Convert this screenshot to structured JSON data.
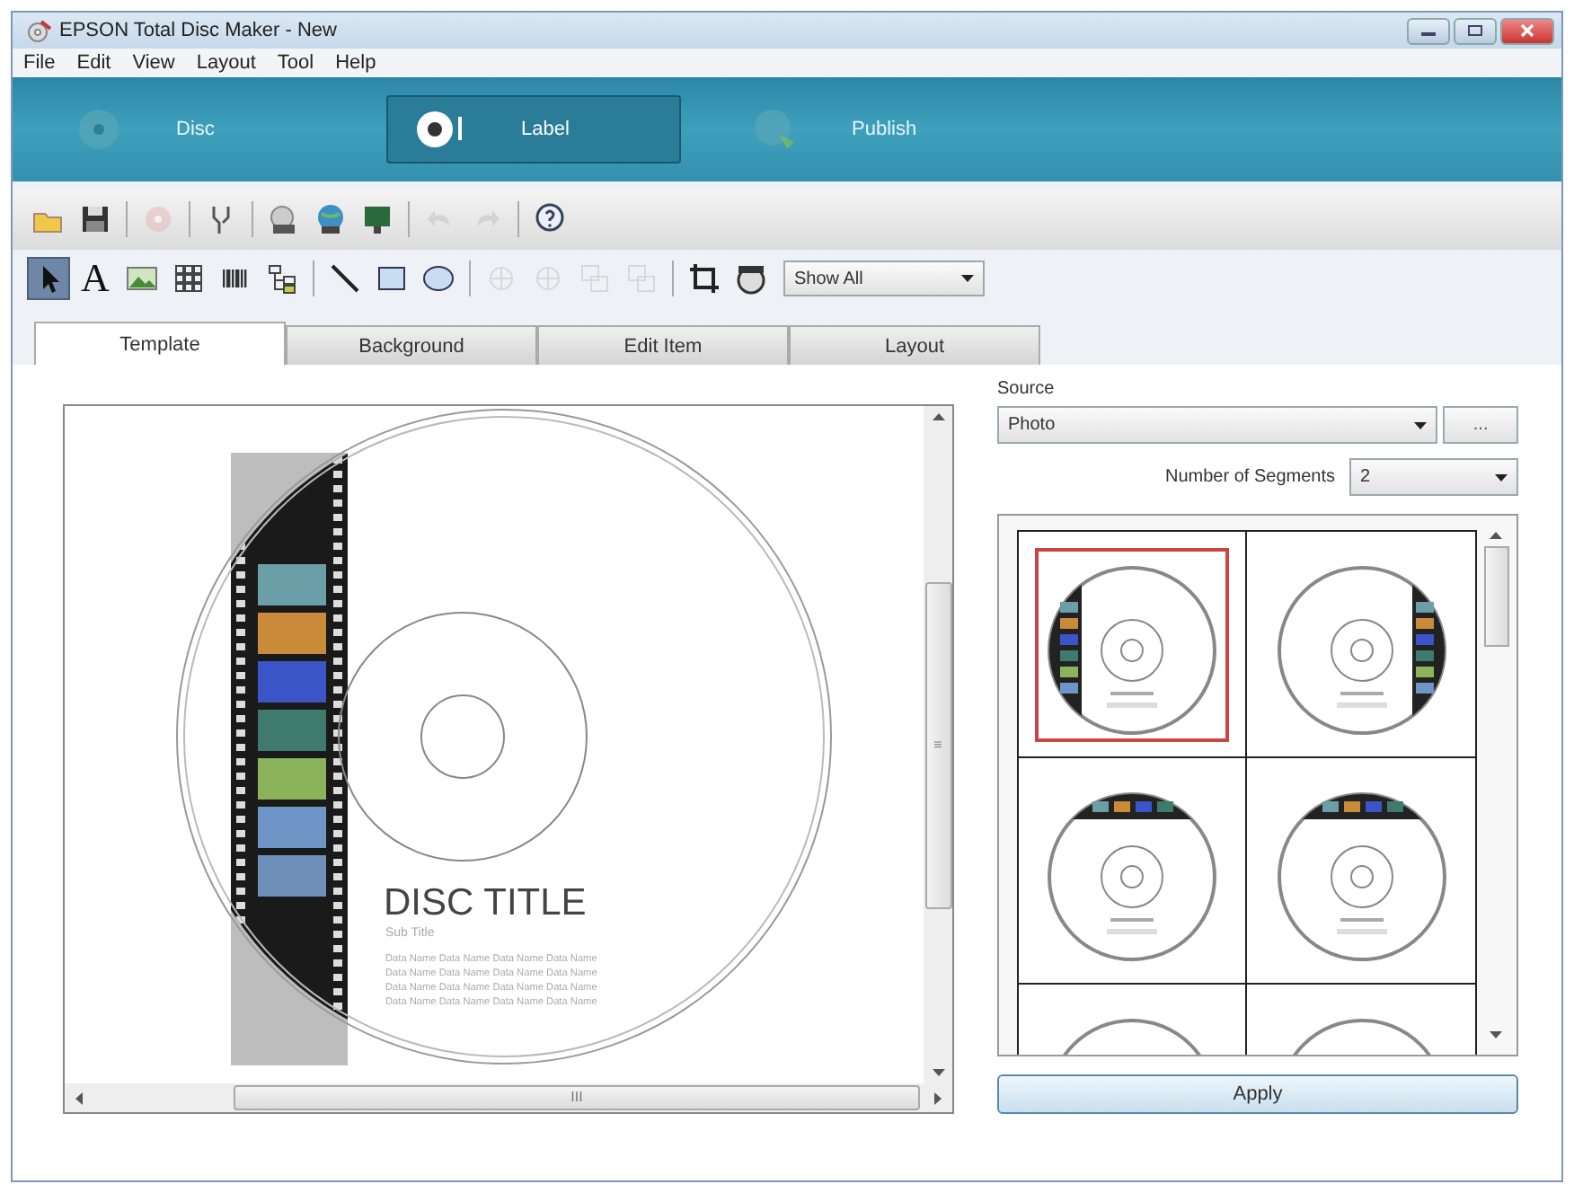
{
  "window": {
    "title": "EPSON Total Disc Maker - New"
  },
  "menu": [
    "File",
    "Edit",
    "View",
    "Layout",
    "Tool",
    "Help"
  ],
  "modes": [
    {
      "kind": "disc",
      "label": "Disc",
      "selected": false
    },
    {
      "kind": "label",
      "label": "Label",
      "selected": true
    },
    {
      "kind": "publish",
      "label": "Publish",
      "selected": false
    }
  ],
  "toolbar_1": [
    {
      "kind": "open",
      "disabled": false
    },
    {
      "kind": "save",
      "disabled": false
    },
    {
      "kind": "separator"
    },
    {
      "kind": "disc",
      "disabled": true
    },
    {
      "kind": "separator"
    },
    {
      "kind": "tool",
      "disabled": false
    },
    {
      "kind": "separator"
    },
    {
      "kind": "print-setup",
      "disabled": false
    },
    {
      "kind": "globe",
      "disabled": false
    },
    {
      "kind": "monitor",
      "disabled": false
    },
    {
      "kind": "separator"
    },
    {
      "kind": "undo",
      "disabled": true
    },
    {
      "kind": "redo",
      "disabled": true
    },
    {
      "kind": "separator"
    },
    {
      "kind": "help",
      "disabled": false
    }
  ],
  "toolbar_2": [
    {
      "kind": "pointer",
      "disabled": false,
      "selected": true
    },
    {
      "kind": "text",
      "glyph": "A",
      "disabled": false,
      "selected": false
    },
    {
      "kind": "image",
      "disabled": false,
      "selected": false
    },
    {
      "kind": "grid",
      "disabled": false,
      "selected": false
    },
    {
      "kind": "barcode",
      "disabled": false,
      "selected": false
    },
    {
      "kind": "tree",
      "disabled": false,
      "selected": false
    },
    {
      "kind": "separator"
    },
    {
      "kind": "line",
      "disabled": false,
      "selected": false
    },
    {
      "kind": "rectangle",
      "disabled": false,
      "selected": false
    },
    {
      "kind": "ellipse",
      "disabled": false,
      "selected": false
    },
    {
      "kind": "separator"
    },
    {
      "kind": "align-h",
      "disabled": true,
      "selected": false
    },
    {
      "kind": "align-v",
      "disabled": true,
      "selected": false
    },
    {
      "kind": "front",
      "disabled": true,
      "selected": false
    },
    {
      "kind": "back",
      "disabled": true,
      "selected": false
    },
    {
      "kind": "separator"
    },
    {
      "kind": "crop",
      "disabled": false,
      "selected": false
    },
    {
      "kind": "face",
      "disabled": false,
      "selected": false
    }
  ],
  "view_dropdown": {
    "value": "Show All"
  },
  "tabs": [
    {
      "label": "Template",
      "selected": true
    },
    {
      "label": "Background",
      "selected": false
    },
    {
      "label": "Edit Item",
      "selected": false
    },
    {
      "label": "Layout",
      "selected": false
    }
  ],
  "canvas": {
    "title": "DISC TITLE",
    "subtitle": "Sub Title",
    "data_lines": [
      "Data Name Data Name Data Name Data Name",
      "Data Name Data Name Data Name Data Name",
      "Data Name Data Name Data Name Data Name",
      "Data Name Data Name Data Name Data Name"
    ],
    "scrollbar_grip": "≡",
    "h_scrollbar_grip": "III"
  },
  "panel": {
    "source_label": "Source",
    "source_value": "Photo",
    "browse_button": "...",
    "segments_label": "Number of Segments",
    "segments_value": "2",
    "templates": [
      {
        "kind": "left-strip",
        "selected": true
      },
      {
        "kind": "right-strip",
        "selected": false
      },
      {
        "kind": "top-strip",
        "selected": false
      },
      {
        "kind": "top-strip",
        "selected": false
      },
      {
        "kind": "plain",
        "selected": false
      },
      {
        "kind": "plain",
        "selected": false
      }
    ],
    "apply_button": "Apply"
  }
}
